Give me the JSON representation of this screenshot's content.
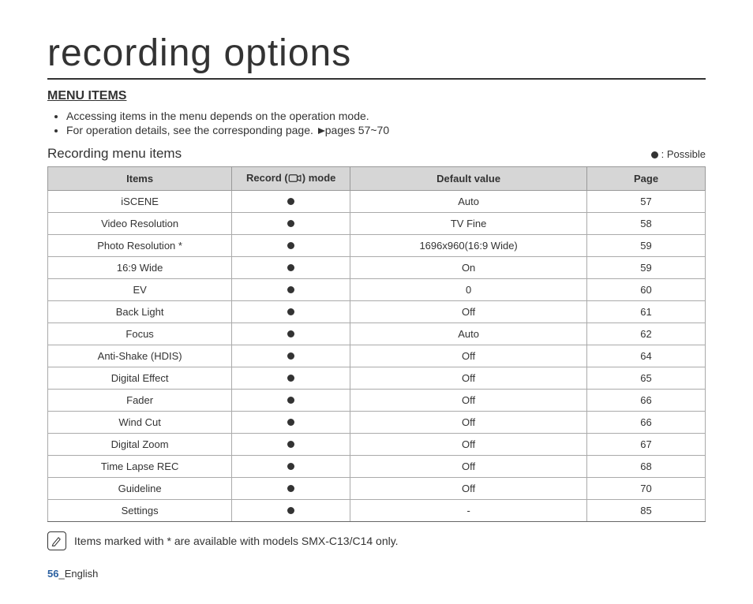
{
  "title": "recording options",
  "section_heading": "MENU ITEMS",
  "bullets": [
    "Accessing items in the menu depends on the operation mode.",
    "For operation details, see the corresponding page."
  ],
  "page_ref": "pages 57~70",
  "subtitle": "Recording menu items",
  "legend_text": ": Possible",
  "headers": {
    "items": "Items",
    "record_prefix": "Record (",
    "record_suffix": ") mode",
    "default": "Default value",
    "page": "Page"
  },
  "rows": [
    {
      "item": "iSCENE",
      "record": true,
      "default": "Auto",
      "page": "57"
    },
    {
      "item": "Video Resolution",
      "record": true,
      "default": "TV Fine",
      "page": "58"
    },
    {
      "item": "Photo Resolution *",
      "record": true,
      "default": "1696x960(16:9 Wide)",
      "page": "59"
    },
    {
      "item": "16:9 Wide",
      "record": true,
      "default": "On",
      "page": "59"
    },
    {
      "item": "EV",
      "record": true,
      "default": "0",
      "page": "60"
    },
    {
      "item": "Back Light",
      "record": true,
      "default": "Off",
      "page": "61"
    },
    {
      "item": "Focus",
      "record": true,
      "default": "Auto",
      "page": "62"
    },
    {
      "item": "Anti-Shake (HDIS)",
      "record": true,
      "default": "Off",
      "page": "64"
    },
    {
      "item": "Digital Effect",
      "record": true,
      "default": "Off",
      "page": "65"
    },
    {
      "item": "Fader",
      "record": true,
      "default": "Off",
      "page": "66"
    },
    {
      "item": "Wind Cut",
      "record": true,
      "default": "Off",
      "page": "66"
    },
    {
      "item": "Digital Zoom",
      "record": true,
      "default": "Off",
      "page": "67"
    },
    {
      "item": "Time Lapse REC",
      "record": true,
      "default": "Off",
      "page": "68"
    },
    {
      "item": "Guideline",
      "record": true,
      "default": "Off",
      "page": "70"
    },
    {
      "item": "Settings",
      "record": true,
      "default": "-",
      "page": "85"
    }
  ],
  "note": "Items marked with * are available with models SMX-C13/C14 only.",
  "footer": {
    "page": "56",
    "lang": "English"
  }
}
